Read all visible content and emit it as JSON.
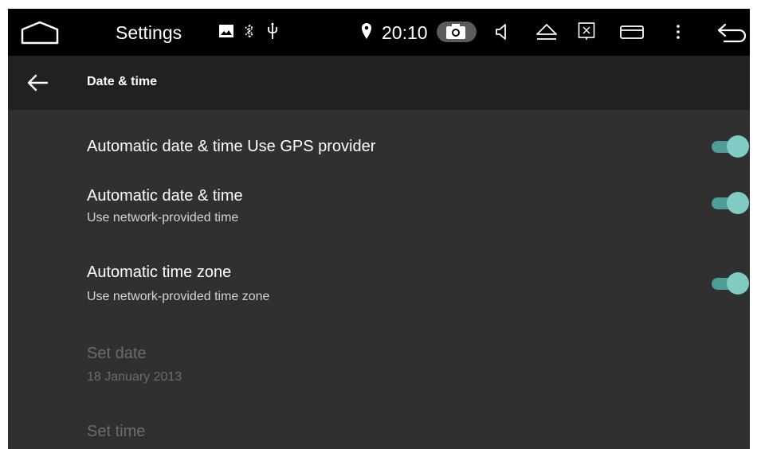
{
  "status_bar": {
    "app_name": "Settings",
    "clock": "20:10",
    "icons": [
      "home-icon",
      "image-icon",
      "bluetooth-icon",
      "usb-icon",
      "location-icon",
      "camera-icon",
      "volume-icon",
      "eject-icon",
      "screen-close-icon",
      "window-icon",
      "overflow-menu-icon",
      "back-icon"
    ]
  },
  "action_bar": {
    "title": "Date & time",
    "back_icon": "arrow-left-icon"
  },
  "settings": [
    {
      "title": "Automatic date & time Use GPS provider",
      "summary": "",
      "switch_on": true,
      "enabled": true
    },
    {
      "title": "Automatic date & time",
      "summary": "Use network-provided time",
      "switch_on": true,
      "enabled": true
    },
    {
      "title": "Automatic time zone",
      "summary": "Use network-provided time zone",
      "switch_on": true,
      "enabled": true
    },
    {
      "title": "Set date",
      "summary": "18 January 2013",
      "enabled": false
    },
    {
      "title": "Set time",
      "summary": "",
      "enabled": false
    }
  ],
  "colors": {
    "background": "#303030",
    "status_bar": "#000000",
    "action_bar": "#212121",
    "switch_thumb": "#80cbc4",
    "switch_track": "#4f9d96",
    "disabled_text": "#6c6c6c"
  }
}
